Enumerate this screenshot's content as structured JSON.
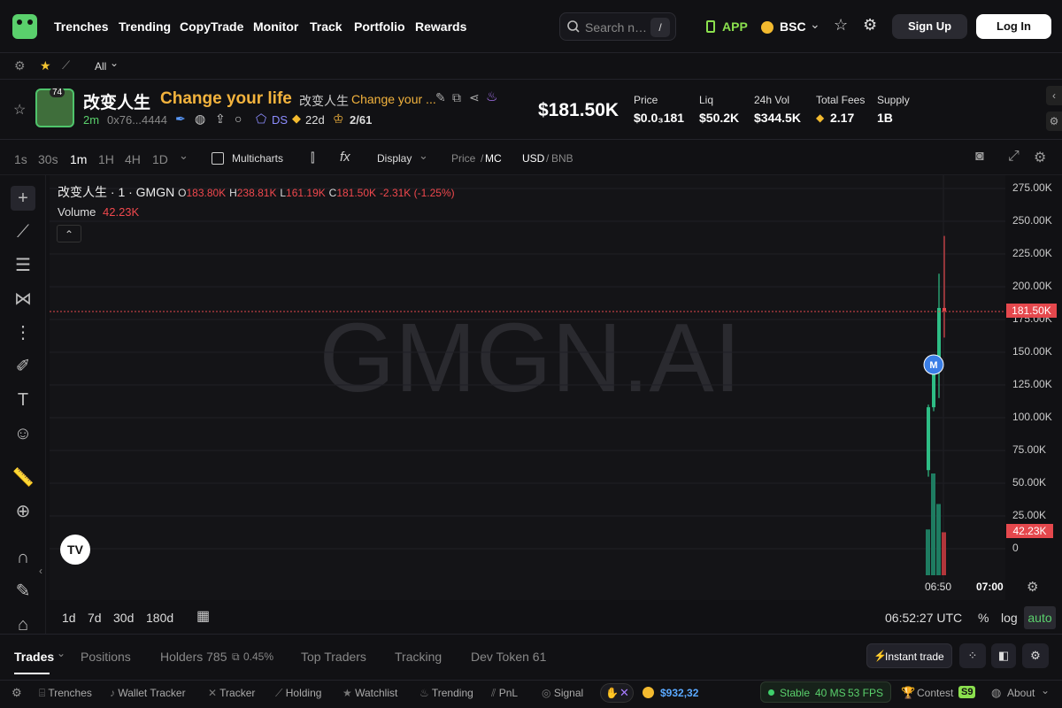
{
  "nav": {
    "items": [
      "Trenches",
      "Trending",
      "CopyTrade",
      "Monitor",
      "Track",
      "Portfolio",
      "Rewards"
    ],
    "search_placeholder": "Search n…",
    "search_key": "/",
    "app": "APP",
    "chain": "BSC",
    "signup": "Sign Up",
    "login": "Log In"
  },
  "subbar": {
    "filter": "All"
  },
  "token": {
    "rank": "74",
    "name_cn": "改变人生",
    "name_en": "Change your life",
    "name_cn2": "改变人生",
    "name_en2": "Change your ...",
    "age": "2m",
    "address": "0x76...4444",
    "ds": "DS",
    "days": "22d",
    "holders_ratio": "2/61",
    "mcap": "$181.50K",
    "stats": [
      {
        "label": "Price",
        "value": "$0.0₃181"
      },
      {
        "label": "Liq",
        "value": "$50.2K"
      },
      {
        "label": "24h Vol",
        "value": "$344.5K"
      },
      {
        "label": "Total Fees",
        "value": "2.17"
      },
      {
        "label": "Supply",
        "value": "1B"
      }
    ]
  },
  "toolbar": {
    "intervals": [
      "1s",
      "30s",
      "1m",
      "1H",
      "4H",
      "1D"
    ],
    "active": "1m",
    "multicharts": "Multicharts",
    "display": "Display",
    "price": "Price",
    "mc": "MC",
    "usd": "USD",
    "bnb": "BNB"
  },
  "legend": {
    "symbol": "改变人生 · 1 · GMGN",
    "o_label": "O",
    "o": "183.80K",
    "h_label": "H",
    "h": "238.81K",
    "l_label": "L",
    "l": "161.19K",
    "c_label": "C",
    "c": "181.50K",
    "chg": "-2.31K (-1.25%)",
    "volume_label": "Volume",
    "volume": "42.23K"
  },
  "watermark": "GMGN.AI",
  "chart_data": {
    "type": "candlestick",
    "y_ticks": [
      "275.00K",
      "250.00K",
      "225.00K",
      "200.00K",
      "175.00K",
      "150.00K",
      "125.00K",
      "100.00K",
      "75.00K",
      "50.00K",
      "25.00K",
      "0"
    ],
    "ylim": [
      0,
      275000
    ],
    "x_ticks": [
      "06:50",
      "07:00"
    ],
    "last_price_label": "181.50K",
    "last_volume_label": "42.23K",
    "marker": "M",
    "candles": [
      {
        "o": 60000,
        "h": 110000,
        "l": 55000,
        "c": 108000
      },
      {
        "o": 108000,
        "h": 145000,
        "l": 105000,
        "c": 140000
      },
      {
        "o": 140000,
        "h": 210000,
        "l": 115000,
        "c": 183800
      },
      {
        "o": 183800,
        "h": 238810,
        "l": 161190,
        "c": 181500
      }
    ],
    "volumes": [
      {
        "v": 45000,
        "up": true
      },
      {
        "v": 100000,
        "up": true
      },
      {
        "v": 70000,
        "up": true
      },
      {
        "v": 42230,
        "up": false
      }
    ]
  },
  "range": {
    "items": [
      "1d",
      "7d",
      "30d",
      "180d"
    ],
    "time": "06:52:27 UTC",
    "pct": "%",
    "log": "log",
    "auto": "auto"
  },
  "tabs": {
    "items": [
      "Trades",
      "Positions",
      "Holders 785",
      "Top Traders",
      "Tracking",
      "Dev Token 61"
    ],
    "holders_pct": "0.45%",
    "instant": "Instant trade"
  },
  "status": {
    "items": [
      "Trenches",
      "Wallet Tracker",
      "Tracker",
      "Holding",
      "Watchlist",
      "Trending",
      "PnL",
      "Signal"
    ],
    "balance": "$932,32",
    "stable": "Stable",
    "ms": "40 MS",
    "fps": "53 FPS",
    "contest": "Contest",
    "s9": "S9",
    "about": "About"
  }
}
